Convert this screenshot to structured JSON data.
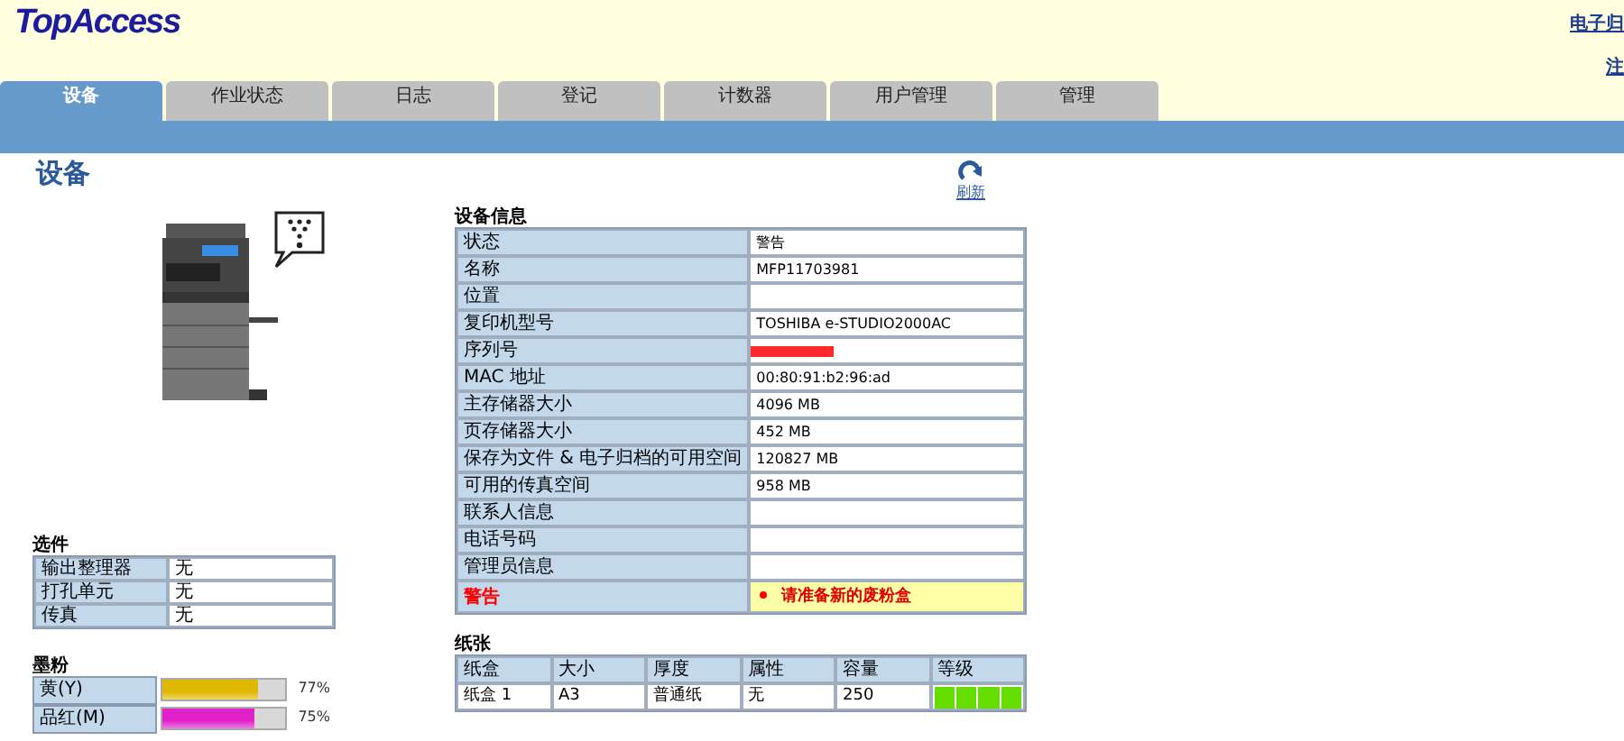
{
  "header": {
    "logo": "TopAccess",
    "links": [
      "电子归",
      "注"
    ]
  },
  "tabs": [
    {
      "label": "设备",
      "selected": true
    },
    {
      "label": "作业状态",
      "selected": false
    },
    {
      "label": "日志",
      "selected": false
    },
    {
      "label": "登记",
      "selected": false
    },
    {
      "label": "计数器",
      "selected": false
    },
    {
      "label": "用户管理",
      "selected": false
    },
    {
      "label": "管理",
      "selected": false
    }
  ],
  "page_title": "设备",
  "refresh": {
    "label": "刷新"
  },
  "options": {
    "title": "选件",
    "rows": [
      {
        "label": "输出整理器",
        "value": "无"
      },
      {
        "label": "打孔单元",
        "value": "无"
      },
      {
        "label": "传真",
        "value": "无"
      }
    ]
  },
  "toner": {
    "title": "墨粉",
    "rows": [
      {
        "label": "黄(Y)",
        "color": "#e0b800",
        "level": 0.77,
        "reading": "77%"
      },
      {
        "label": "品红(M)",
        "color": "#e020c8",
        "level": 0.75,
        "reading": "75%"
      }
    ]
  },
  "device_info": {
    "title": "设备信息",
    "rows": [
      {
        "label": "状态",
        "value": "警告",
        "kind": "text"
      },
      {
        "label": "名称",
        "value": "MFP11703981",
        "kind": "text"
      },
      {
        "label": "位置",
        "kind": "text"
      },
      {
        "label": "复印机型号",
        "value": "TOSHIBA e-STUDIO2000AC",
        "kind": "text"
      },
      {
        "label": "序列号",
        "kind": "redacted"
      },
      {
        "label": "MAC 地址",
        "value": "00:80:91:b2:96:ad",
        "kind": "text"
      },
      {
        "label": "主存储器大小",
        "value": "4096 MB",
        "kind": "text"
      },
      {
        "label": "页存储器大小",
        "value": "452 MB",
        "kind": "text"
      },
      {
        "label": "保存为文件 & 电子归档的可用空间",
        "value": "120827 MB",
        "kind": "text"
      },
      {
        "label": "可用的传真空间",
        "value": "958 MB",
        "kind": "text"
      },
      {
        "label": "联系人信息",
        "kind": "text"
      },
      {
        "label": "电话号码",
        "kind": "text"
      },
      {
        "label": "管理员信息",
        "kind": "text"
      },
      {
        "label": "警告",
        "value": "请准备新的废粉盒",
        "kind": "warning"
      }
    ]
  },
  "paper": {
    "title": "纸张",
    "columns": [
      "纸盒",
      "大小",
      "厚度",
      "属性",
      "容量",
      "等级"
    ],
    "rows": [
      {
        "tray": "纸盒 1",
        "size": "A3",
        "thickness": "普通纸",
        "attribute": "无",
        "capacity": "250",
        "level": 1
      }
    ]
  }
}
